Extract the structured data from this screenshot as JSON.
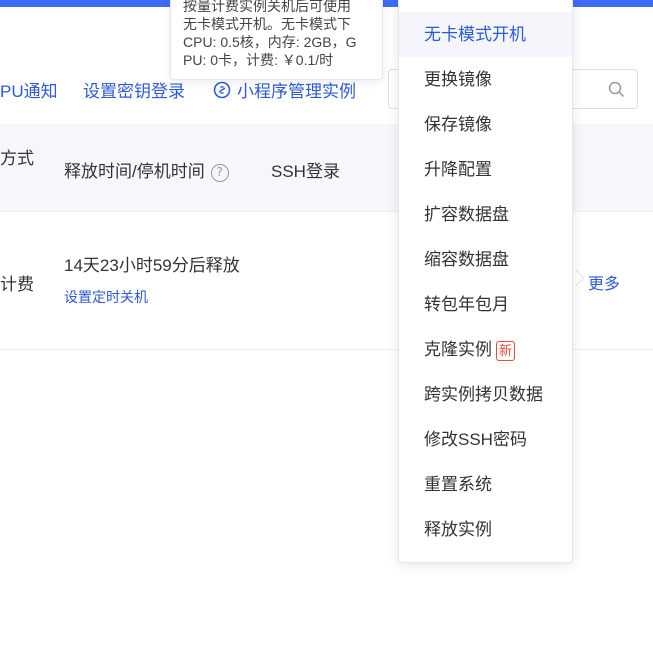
{
  "colors": {
    "accent": "#3F6BF6",
    "link": "#2d5bd6",
    "badge": "#e84a3c"
  },
  "toolbar": {
    "gpu_notice": "PU通知",
    "set_key_login": "设置密钥登录",
    "miniprogram_manage": "小程序管理实例",
    "miniprogram_icon": "link-icon"
  },
  "search": {
    "placeholder": "",
    "value": "",
    "icon": "search-icon"
  },
  "table": {
    "headers": {
      "billing_partial": "方式",
      "release_time": "释放时间/停机时间",
      "ssh_login": "SSH登录"
    },
    "row": {
      "billing_partial": "计费",
      "release_text": "14天23小时59分后释放",
      "set_timer_shutdown": "设置定时关机",
      "more": "更多"
    }
  },
  "tooltip": {
    "lines": [
      "按量计费实例关机后可使用",
      "无卡模式开机。无卡模式下",
      "CPU: 0.5核，内存: 2GB，G",
      "PU: 0卡，计费: ￥0.1/时"
    ]
  },
  "dropdown": {
    "items": [
      {
        "label": "无卡模式开机",
        "active": true
      },
      {
        "label": "更换镜像"
      },
      {
        "label": "保存镜像"
      },
      {
        "label": "升降配置"
      },
      {
        "label": "扩容数据盘"
      },
      {
        "label": "缩容数据盘"
      },
      {
        "label": "转包年包月"
      },
      {
        "label": "克隆实例",
        "badge": "新"
      },
      {
        "label": "跨实例拷贝数据"
      },
      {
        "label": "修改SSH密码"
      },
      {
        "label": "重置系统"
      },
      {
        "label": "释放实例"
      }
    ]
  }
}
